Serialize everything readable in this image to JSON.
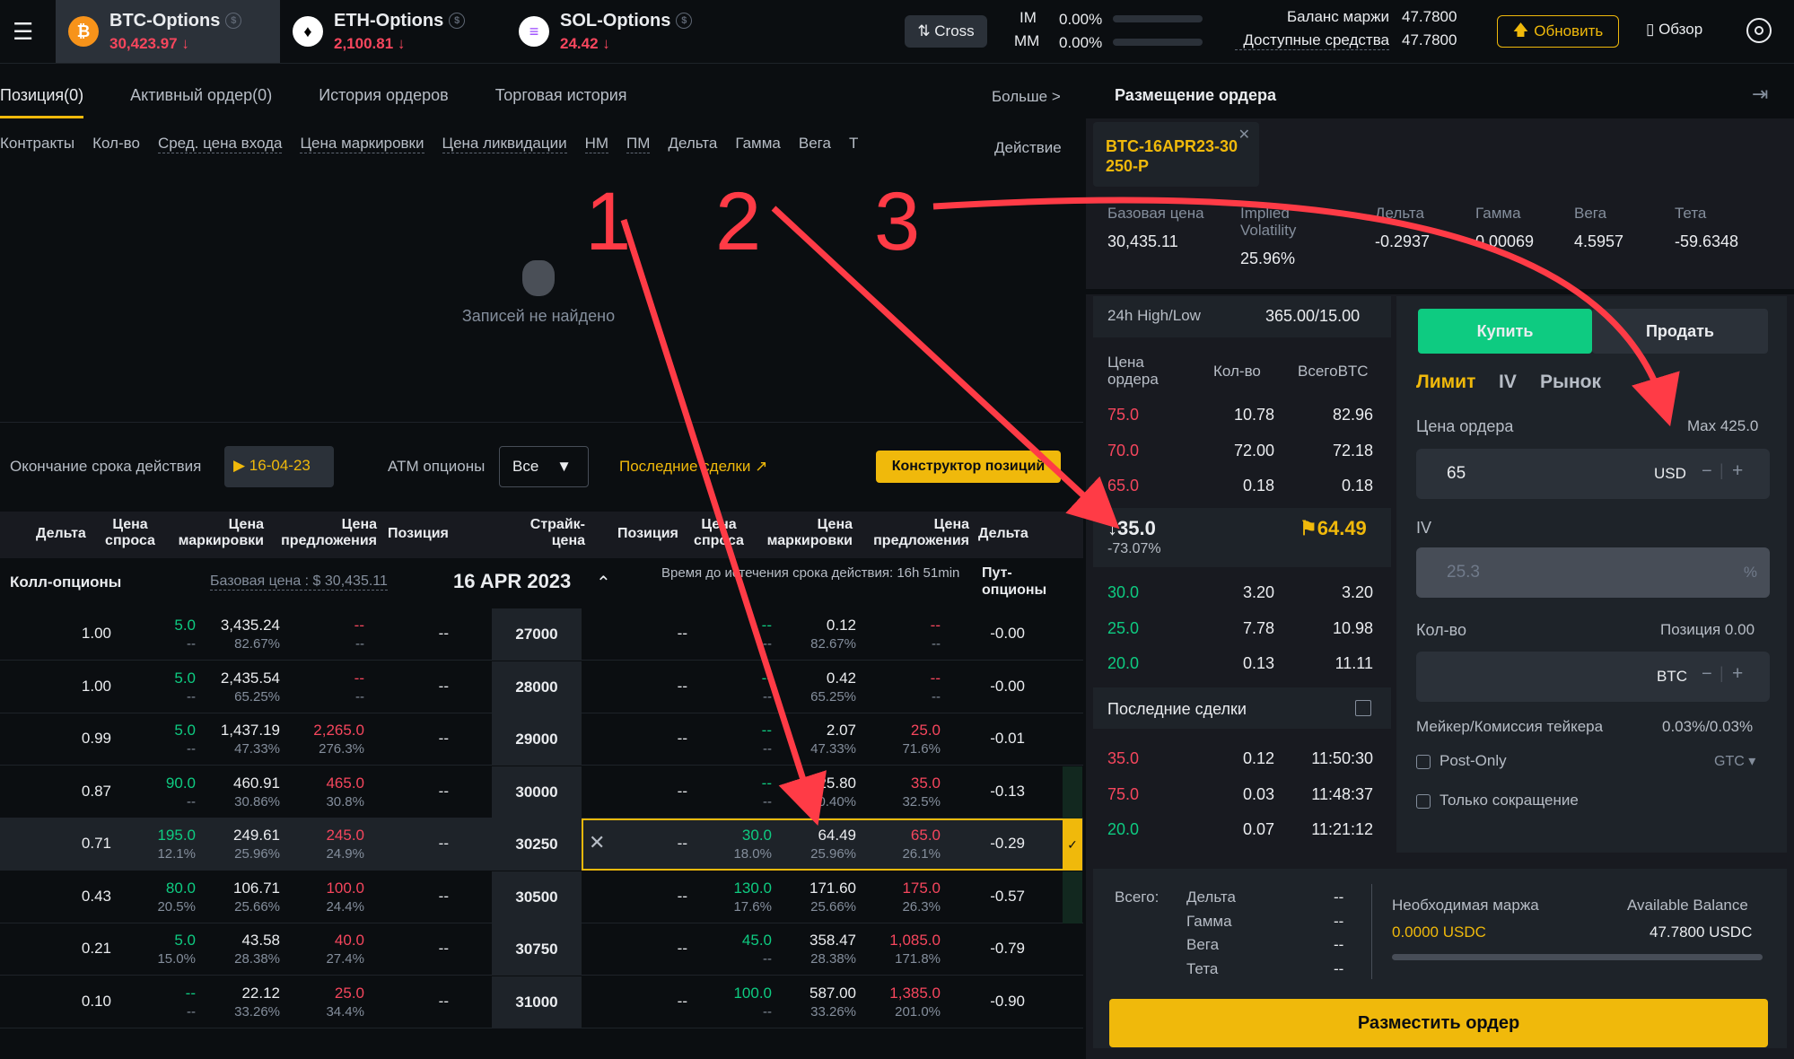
{
  "topbar": {
    "assets": [
      {
        "name": "BTC-Options",
        "price": "30,423.97",
        "coin": "₿",
        "color": "#f7931a"
      },
      {
        "name": "ETH-Options",
        "price": "2,100.81",
        "coin": "♦",
        "color": "#ffffff"
      },
      {
        "name": "SOL-Options",
        "price": "24.42",
        "coin": "≡",
        "color": "#ffffff"
      }
    ],
    "cross_label": "Cross",
    "im_label": "IM",
    "im_value": "0.00%",
    "mm_label": "MM",
    "mm_value": "0.00%",
    "margin_balance_label": "Баланс маржи",
    "margin_balance_value": "47.7800",
    "available_label": "Доступные средства",
    "available_value": "47.7800",
    "update_label": "Обновить",
    "overview_label": "Обзор"
  },
  "position_tabs": [
    "Позиция(0)",
    "Активный ордер(0)",
    "История ордеров",
    "Торговая история"
  ],
  "more_label": "Больше >",
  "position_columns": [
    "Контракты",
    "Кол-во",
    "Сред. цена входа",
    "Цена маркировки",
    "Цена ликвидации",
    "НМ",
    "ПМ",
    "Дельта",
    "Гамма",
    "Вега",
    "Т"
  ],
  "action_label": "Действие",
  "empty_text": "Записей не найдено",
  "filters": {
    "expiry_label": "Окончание срока действия",
    "expiry_value": "16-04-23",
    "atm_label": "ATM опционы",
    "atm_value": "Все",
    "last_trades_label": "Последние сделки",
    "builder_label": "Конструктор позиций"
  },
  "chain_headers": {
    "left": [
      "Дельта",
      "Цена спроса",
      "Цена маркировки",
      "Цена предложения",
      "Позиция"
    ],
    "strike": "Страйк-цена",
    "right": [
      "Позиция",
      "Цена спроса",
      "Цена маркировки",
      "Цена предложения",
      "Дельта"
    ]
  },
  "chain_meta": {
    "calls_label": "Колл-опционы",
    "base_price": "Базовая цена : $ 30,435.11",
    "date": "16 APR 2023",
    "time_to_expiry": "Время до истечения срока действия:  16h 51min",
    "puts_label": "Пут-опционы"
  },
  "chain_rows": [
    {
      "strike": "27000",
      "c_delta": "1.00",
      "c_bid": "5.0",
      "c_bid_iv": "--",
      "c_mark": "3,435.24",
      "c_mark_iv": "82.67%",
      "c_ask": "--",
      "c_ask_iv": "--",
      "c_pos": "--",
      "p_pos": "--",
      "p_bid": "--",
      "p_bid_iv": "--",
      "p_mark": "0.12",
      "p_mark_iv": "82.67%",
      "p_ask": "--",
      "p_ask_iv": "--",
      "p_delta": "-0.00"
    },
    {
      "strike": "28000",
      "c_delta": "1.00",
      "c_bid": "5.0",
      "c_bid_iv": "--",
      "c_mark": "2,435.54",
      "c_mark_iv": "65.25%",
      "c_ask": "--",
      "c_ask_iv": "--",
      "c_pos": "--",
      "p_pos": "--",
      "p_bid": "--",
      "p_bid_iv": "--",
      "p_mark": "0.42",
      "p_mark_iv": "65.25%",
      "p_ask": "--",
      "p_ask_iv": "--",
      "p_delta": "-0.00"
    },
    {
      "strike": "29000",
      "c_delta": "0.99",
      "c_bid": "5.0",
      "c_bid_iv": "--",
      "c_mark": "1,437.19",
      "c_mark_iv": "47.33%",
      "c_ask": "2,265.0",
      "c_ask_iv": "276.3%",
      "c_pos": "--",
      "p_pos": "--",
      "p_bid": "--",
      "p_bid_iv": "--",
      "p_mark": "2.07",
      "p_mark_iv": "47.33%",
      "p_ask": "25.0",
      "p_ask_iv": "71.6%",
      "p_delta": "-0.01"
    },
    {
      "strike": "30000",
      "c_delta": "0.87",
      "c_bid": "90.0",
      "c_bid_iv": "--",
      "c_mark": "460.91",
      "c_mark_iv": "30.86%",
      "c_ask": "465.0",
      "c_ask_iv": "30.8%",
      "c_pos": "--",
      "p_pos": "--",
      "p_bid": "--",
      "p_bid_iv": "--",
      "p_mark": "25.80",
      "p_mark_iv": "30.40%",
      "p_ask": "35.0",
      "p_ask_iv": "32.5%",
      "p_delta": "-0.13"
    },
    {
      "strike": "30250",
      "c_delta": "0.71",
      "c_bid": "195.0",
      "c_bid_iv": "12.1%",
      "c_mark": "249.61",
      "c_mark_iv": "25.96%",
      "c_ask": "245.0",
      "c_ask_iv": "24.9%",
      "c_pos": "--",
      "p_pos": "--",
      "p_bid": "30.0",
      "p_bid_iv": "18.0%",
      "p_mark": "64.49",
      "p_mark_iv": "25.96%",
      "p_ask": "65.0",
      "p_ask_iv": "26.1%",
      "p_delta": "-0.29"
    },
    {
      "strike": "30500",
      "c_delta": "0.43",
      "c_bid": "80.0",
      "c_bid_iv": "20.5%",
      "c_mark": "106.71",
      "c_mark_iv": "25.66%",
      "c_ask": "100.0",
      "c_ask_iv": "24.4%",
      "c_pos": "--",
      "p_pos": "--",
      "p_bid": "130.0",
      "p_bid_iv": "17.6%",
      "p_mark": "171.60",
      "p_mark_iv": "25.66%",
      "p_ask": "175.0",
      "p_ask_iv": "26.3%",
      "p_delta": "-0.57"
    },
    {
      "strike": "30750",
      "c_delta": "0.21",
      "c_bid": "5.0",
      "c_bid_iv": "15.0%",
      "c_mark": "43.58",
      "c_mark_iv": "28.38%",
      "c_ask": "40.0",
      "c_ask_iv": "27.4%",
      "c_pos": "--",
      "p_pos": "--",
      "p_bid": "45.0",
      "p_bid_iv": "--",
      "p_mark": "358.47",
      "p_mark_iv": "28.38%",
      "p_ask": "1,085.0",
      "p_ask_iv": "171.8%",
      "p_delta": "-0.79"
    },
    {
      "strike": "31000",
      "c_delta": "0.10",
      "c_bid": "--",
      "c_bid_iv": "--",
      "c_mark": "22.12",
      "c_mark_iv": "33.26%",
      "c_ask": "25.0",
      "c_ask_iv": "34.4%",
      "c_pos": "--",
      "p_pos": "--",
      "p_bid": "100.0",
      "p_bid_iv": "--",
      "p_mark": "587.00",
      "p_mark_iv": "33.26%",
      "p_ask": "1,385.0",
      "p_ask_iv": "201.0%",
      "p_delta": "-0.90"
    }
  ],
  "order_panel": {
    "title": "Размещение ордера",
    "contract": "BTC-16APR23-30250-P",
    "greeks": [
      {
        "label": "Базовая цена",
        "value": "30,435.11"
      },
      {
        "label": "Implied Volatility",
        "value": "25.96%"
      },
      {
        "label": "Дельта",
        "value": "-0.2937"
      },
      {
        "label": "Гамма",
        "value": "0.00069"
      },
      {
        "label": "Вега",
        "value": "4.5957"
      },
      {
        "label": "Тета",
        "value": "-59.6348"
      }
    ],
    "hl_label": "24h High/Low",
    "hl_value": "365.00/15.00",
    "ob_headers": [
      "Цена ордера",
      "Кол-во",
      "ВсегоBTC"
    ],
    "asks": [
      [
        "75.0",
        "10.78",
        "82.96"
      ],
      [
        "70.0",
        "72.00",
        "72.18"
      ],
      [
        "65.0",
        "0.18",
        "0.18"
      ]
    ],
    "last_price": "35.0",
    "last_change": "-73.07%",
    "mark_price": "64.49",
    "bids": [
      [
        "30.0",
        "3.20",
        "3.20"
      ],
      [
        "25.0",
        "7.78",
        "10.98"
      ],
      [
        "20.0",
        "0.13",
        "11.11"
      ]
    ],
    "recent_label": "Последние сделки",
    "recent": [
      [
        "35.0",
        "0.12",
        "11:50:30"
      ],
      [
        "75.0",
        "0.03",
        "11:48:37"
      ],
      [
        "20.0",
        "0.07",
        "11:21:12"
      ]
    ],
    "buy_label": "Купить",
    "sell_label": "Продать",
    "order_types": [
      "Лимит",
      "IV",
      "Рынок"
    ],
    "price_label": "Цена ордера",
    "price_max": "Max 425.0",
    "price_value": "65",
    "price_unit": "USD",
    "iv_label": "IV",
    "iv_placeholder": "25.3",
    "iv_unit": "%",
    "qty_label": "Кол-во",
    "position_label": "Позиция 0.00",
    "qty_unit": "BTC",
    "fee_label": "Мейкер/Комиссия тейкера",
    "fee_value": "0.03%/0.03%",
    "post_only": "Post-Only",
    "tif": "GTC",
    "reduce_only": "Только сокращение",
    "total_label": "Всего:",
    "totals": [
      [
        "Дельта",
        "--"
      ],
      [
        "Гамма",
        "--"
      ],
      [
        "Вега",
        "--"
      ],
      [
        "Тета",
        "--"
      ]
    ],
    "req_margin_label": "Необходимая маржа",
    "req_margin_value": "0.0000 USDC",
    "avail_label": "Available Balance",
    "avail_value": "47.7800 USDC",
    "place_label": "Разместить ордер"
  },
  "annotations": [
    "1",
    "2",
    "3"
  ]
}
